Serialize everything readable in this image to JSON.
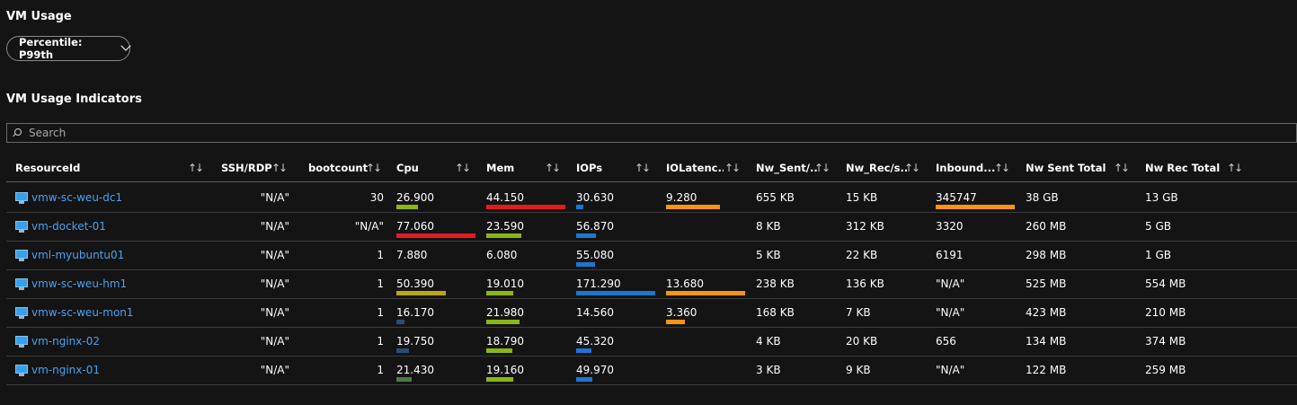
{
  "page": {
    "title": "VM Usage",
    "percentile_label": "Percentile: P99th",
    "section_title": "VM Usage Indicators"
  },
  "search": {
    "placeholder": "Search"
  },
  "columns": [
    {
      "key": "resource",
      "label": "ResourceId",
      "sortable": true
    },
    {
      "key": "ssh",
      "label": "SSH/RDP",
      "sortable": true
    },
    {
      "key": "boot",
      "label": "bootcount",
      "sortable": true
    },
    {
      "key": "cpu",
      "label": "Cpu",
      "sortable": true
    },
    {
      "key": "mem",
      "label": "Mem",
      "sortable": true
    },
    {
      "key": "iops",
      "label": "IOPs",
      "sortable": true
    },
    {
      "key": "iolat",
      "label": "IOLatenc...",
      "sortable": true
    },
    {
      "key": "nwsent",
      "label": "Nw_Sent/...",
      "sortable": true
    },
    {
      "key": "nwrec",
      "label": "Nw_Rec/s...",
      "sortable": true
    },
    {
      "key": "inbound",
      "label": "Inbound...",
      "sortable": true
    },
    {
      "key": "nwsenttotal",
      "label": "Nw Sent Total",
      "sortable": true
    },
    {
      "key": "nwrectotal",
      "label": "Nw Rec Total",
      "sortable": true
    }
  ],
  "colors": {
    "link": "#4ea1ef",
    "bar_red": "#e31b23",
    "bar_olive": "#bba51c",
    "bar_green": "#8bb715",
    "bar_blue": "#1a78d2",
    "bar_orange": "#fa9414",
    "bar_navy": "#2e4a78",
    "bar_darkgreen": "#4d7a4d"
  },
  "icon_name": "virtual-machine-icon",
  "rows": [
    {
      "resource": "vmw-sc-weu-dc1",
      "ssh": "\"N/A\"",
      "boot": "30",
      "cpu": "26.900",
      "mem": "44.150",
      "iops": "30.630",
      "iolat": "9.280",
      "nwsent": "655 KB",
      "nwrec": "15 KB",
      "inbound": "345747",
      "nwsenttotal": "38 GB",
      "nwrectotal": "13 GB",
      "bars": {
        "cpu": {
          "frac": 0.27,
          "color": "bar_green"
        },
        "mem": {
          "frac": 1.0,
          "color": "bar_red"
        },
        "iops": {
          "frac": 0.09,
          "color": "bar_blue"
        },
        "iolat": {
          "frac": 0.68,
          "color": "bar_orange"
        },
        "inbound": {
          "frac": 1.0,
          "color": "bar_orange"
        }
      }
    },
    {
      "resource": "vm-docket-01",
      "ssh": "\"N/A\"",
      "boot": "\"N/A\"",
      "cpu": "77.060",
      "mem": "23.590",
      "iops": "56.870",
      "iolat": "",
      "nwsent": "8 KB",
      "nwrec": "312 KB",
      "inbound": "3320",
      "nwsenttotal": "260 MB",
      "nwrectotal": "5 GB",
      "bars": {
        "cpu": {
          "frac": 1.0,
          "color": "bar_red"
        },
        "mem": {
          "frac": 0.44,
          "color": "bar_green"
        },
        "iops": {
          "frac": 0.25,
          "color": "bar_blue"
        }
      }
    },
    {
      "resource": "vml-myubuntu01",
      "ssh": "\"N/A\"",
      "boot": "1",
      "cpu": "7.880",
      "mem": "6.080",
      "iops": "55.080",
      "iolat": "",
      "nwsent": "5 KB",
      "nwrec": "22 KB",
      "inbound": "6191",
      "nwsenttotal": "298 MB",
      "nwrectotal": "1 GB",
      "bars": {
        "iops": {
          "frac": 0.24,
          "color": "bar_blue"
        }
      }
    },
    {
      "resource": "vmw-sc-weu-hm1",
      "ssh": "\"N/A\"",
      "boot": "1",
      "cpu": "50.390",
      "mem": "19.010",
      "iops": "171.290",
      "iolat": "13.680",
      "nwsent": "238 KB",
      "nwrec": "136 KB",
      "inbound": "\"N/A\"",
      "nwsenttotal": "525 MB",
      "nwrectotal": "554 MB",
      "bars": {
        "cpu": {
          "frac": 0.62,
          "color": "bar_olive"
        },
        "mem": {
          "frac": 0.34,
          "color": "bar_green"
        },
        "iops": {
          "frac": 1.0,
          "color": "bar_blue"
        },
        "iolat": {
          "frac": 1.0,
          "color": "bar_orange"
        }
      }
    },
    {
      "resource": "vmw-sc-weu-mon1",
      "ssh": "\"N/A\"",
      "boot": "1",
      "cpu": "16.170",
      "mem": "21.980",
      "iops": "14.560",
      "iolat": "3.360",
      "nwsent": "168 KB",
      "nwrec": "7 KB",
      "inbound": "\"N/A\"",
      "nwsenttotal": "423 MB",
      "nwrectotal": "210 MB",
      "bars": {
        "cpu": {
          "frac": 0.1,
          "color": "bar_navy"
        },
        "mem": {
          "frac": 0.42,
          "color": "bar_green"
        },
        "iolat": {
          "frac": 0.24,
          "color": "bar_orange"
        }
      }
    },
    {
      "resource": "vm-nginx-02",
      "ssh": "\"N/A\"",
      "boot": "1",
      "cpu": "19.750",
      "mem": "18.790",
      "iops": "45.320",
      "iolat": "",
      "nwsent": "4 KB",
      "nwrec": "20 KB",
      "inbound": "656",
      "nwsenttotal": "134 MB",
      "nwrectotal": "374 MB",
      "bars": {
        "cpu": {
          "frac": 0.16,
          "color": "bar_navy"
        },
        "mem": {
          "frac": 0.33,
          "color": "bar_green"
        },
        "iops": {
          "frac": 0.19,
          "color": "bar_blue"
        }
      }
    },
    {
      "resource": "vm-nginx-01",
      "ssh": "\"N/A\"",
      "boot": "1",
      "cpu": "21.430",
      "mem": "19.160",
      "iops": "49.970",
      "iolat": "",
      "nwsent": "3 KB",
      "nwrec": "9 KB",
      "inbound": "\"N/A\"",
      "nwsenttotal": "122 MB",
      "nwrectotal": "259 MB",
      "bars": {
        "cpu": {
          "frac": 0.19,
          "color": "bar_darkgreen"
        },
        "mem": {
          "frac": 0.34,
          "color": "bar_green"
        },
        "iops": {
          "frac": 0.21,
          "color": "bar_blue"
        }
      }
    }
  ]
}
